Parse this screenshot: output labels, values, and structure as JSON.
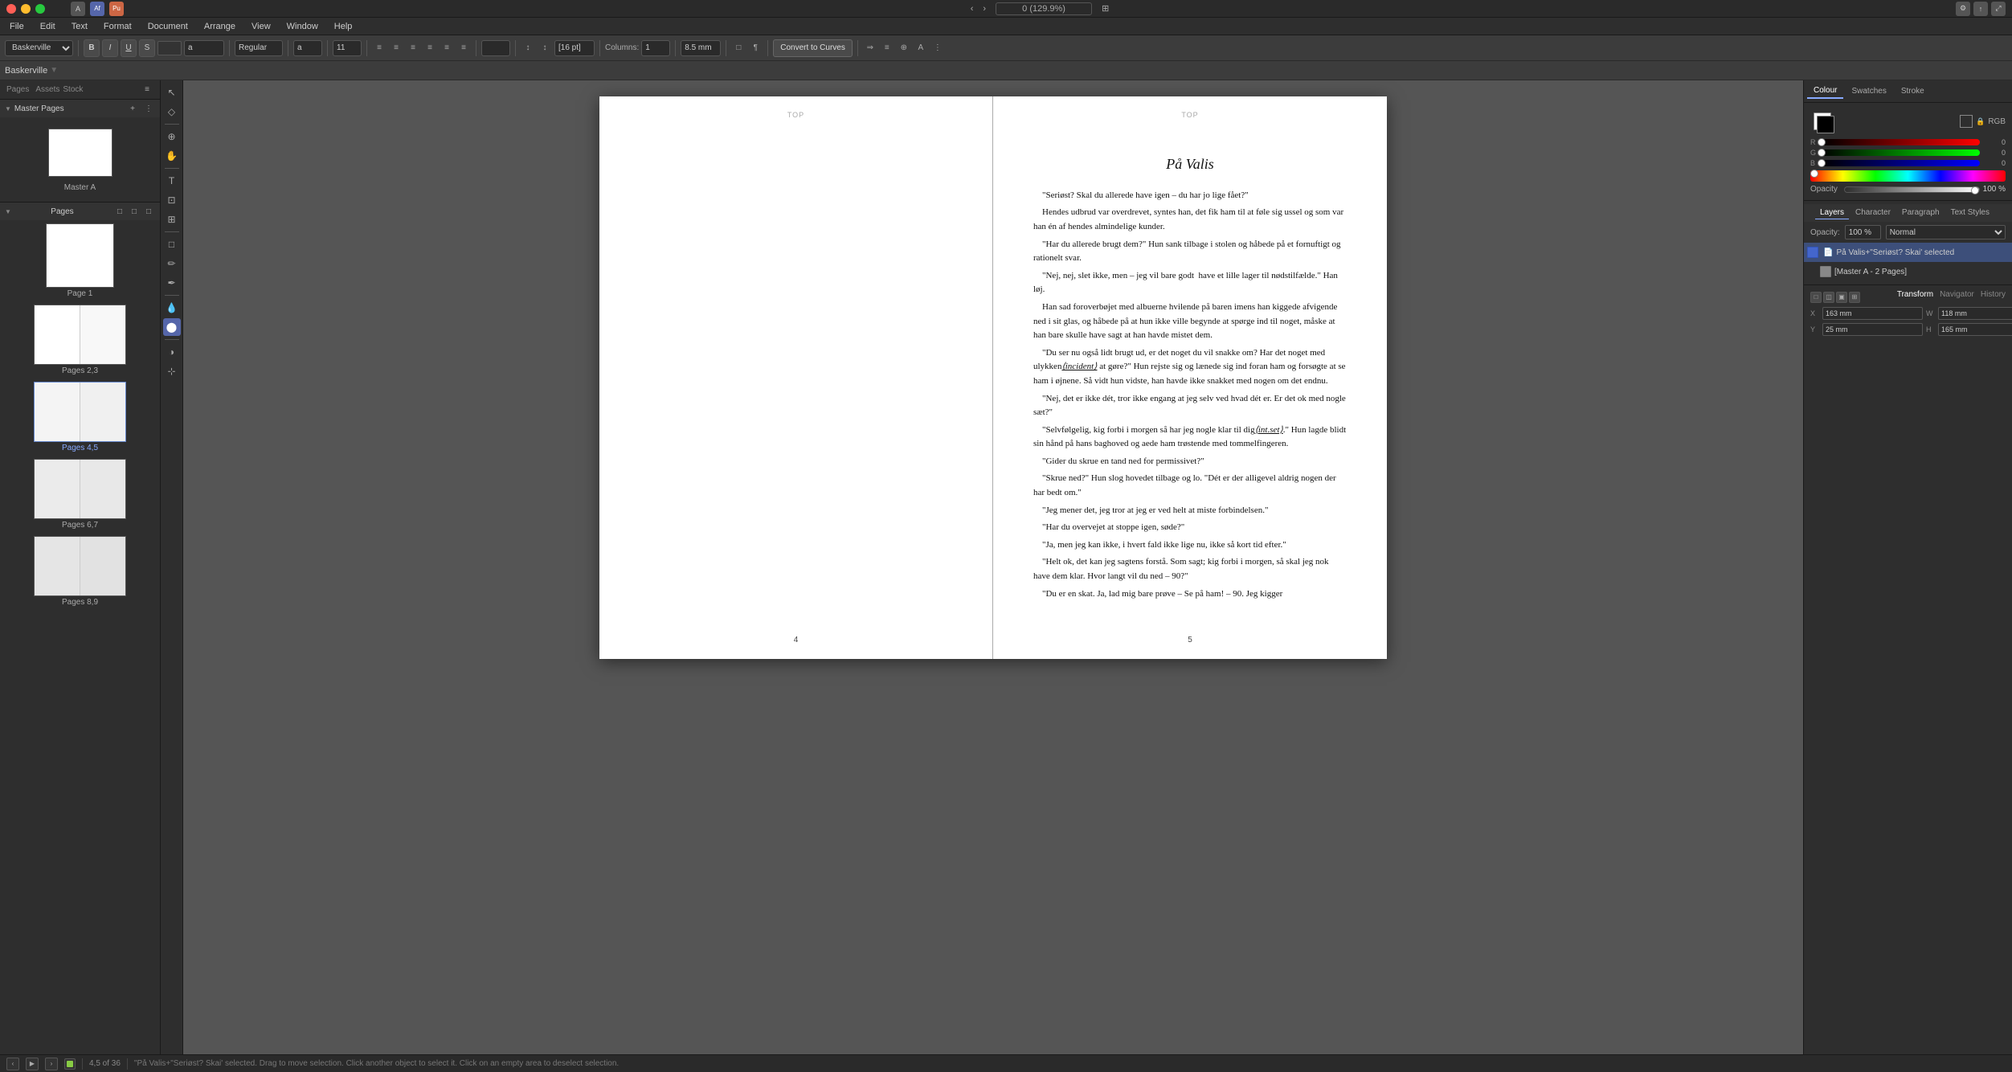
{
  "app": {
    "title": "Affinity Publisher",
    "document_name": "Baskerville"
  },
  "titlebar": {
    "menu_items": [
      "File",
      "Edit",
      "Text",
      "Format",
      "Document",
      "Arrange",
      "View",
      "Window",
      "Help"
    ]
  },
  "toolbar": {
    "font": "Baskerville",
    "font_style": "Regular",
    "font_size": "11",
    "bold_label": "B",
    "italic_label": "I",
    "underline_label": "U",
    "strikethrough_label": "S",
    "convert_to_curves": "Convert to Curves",
    "columns_label": "Columns:",
    "columns_value": "1",
    "gutter_value": "8.5 mm",
    "zoom": "0 (129.9%)"
  },
  "left_panel": {
    "title": "Pages",
    "tabs": [
      "Pages",
      "Assets",
      "Stock"
    ],
    "master_pages_label": "Master Pages",
    "master_page_label": "Master A",
    "pages_label": "Pages",
    "page_groups": [
      {
        "label": "Page 1",
        "type": "single"
      },
      {
        "label": "Pages 2,3",
        "type": "spread"
      },
      {
        "label": "Pages 4,5",
        "type": "spread",
        "selected": true
      },
      {
        "label": "Pages 6,7",
        "type": "spread"
      },
      {
        "label": "Pages 8,9",
        "type": "spread"
      }
    ]
  },
  "canvas": {
    "page_left_number": "4",
    "page_right_number": "5",
    "top_label": "TOP",
    "title": "På Valis",
    "paragraphs": [
      "\"Seriøst? Skal du allerede have igen – du har jo lige fået?\"",
      "Hendes udbrud var overdrevet, syntes han, det fik ham til at føle sig ussel og som var han én af hendes almindelige kunder.",
      "\"Har du allerede brugt dem?\" Hun sank tilbage i stolen og håbede på et fornuftigt og rationelt svar.",
      "\"Nej, nej, slet ikke, men – jeg vil bare godt  have et lille lager til nødstilfælde.\" Han løj.",
      "Han sad foroverbøjet med albuerne hvilende på baren imens han kiggede afvigende ned i sit glas, og håbede på at hun ikke ville begynde at spørge ind til noget, måske at han bare skulle have sagt at han havde mistet dem.",
      "\"Du ser nu også lidt brugt ud, er det noget du vil snakke om? Har det noget med ulykken(incident) at gøre?\" Hun rejste sig og lænede sig ind foran ham og forsøgte at se ham i øjnene. Så vidt hun vidste, han havde ikke snakket med nogen om det endnu.",
      "\"Nej, det er ikke dét, tror ikke engang at jeg selv ved hvad dét er. Er det ok med nogle sæt?\"",
      "\"Selvfølgelig, kig forbi i morgen så har jeg nogle klar til dig(int.set).\" Hun lagde blidt sin hånd på hans baghoved og aede ham trøstende med tommelfingeren.",
      "\"Gider du skrue en tand ned for permissivet?\"",
      "\"Skrue ned?\" Hun slog hovedet tilbage og lo. \"Dét er der alligevel aldrig nogen der har bedt om.\"",
      "\"Jeg mener det, jeg tror at jeg er ved helt at miste forbindelsen.\"",
      "\"Har du overvejet at stoppe igen, søde?\"",
      "\"Ja, men jeg kan ikke, i hvert fald ikke lige nu, ikke så kort tid efter.\"",
      "\"Helt ok, det kan jeg sagtens forstå. Som sagt; kig forbi i morgen, så skal jeg nok have dem klar. Hvor langt vil du ned – 90?\"",
      "\"Du er en skat. Ja, lad mig bare prøve – Se på ham! – 90. Jeg kigger"
    ]
  },
  "right_panel": {
    "tabs": [
      "Colour",
      "Swatches",
      "Stroke"
    ],
    "active_tab": "Colour",
    "color_mode": "RGB",
    "opacity_label": "Opacity",
    "opacity_value": "100 %",
    "layers": {
      "tabs": [
        "Layers",
        "Character",
        "Paragraph",
        "Text Styles"
      ],
      "active_tab": "Layers",
      "opacity_value": "100 %",
      "blend_mode": "Normal",
      "items": [
        {
          "name": "På Valis + \"Seriøst? Skai\" selected",
          "sub": "",
          "active": true,
          "color": "#4466cc"
        },
        {
          "name": "[Master A - 2 Pages]",
          "sub": "",
          "active": false,
          "color": "#888"
        }
      ]
    },
    "transform": {
      "tabs": [
        "Transform",
        "Navigator",
        "History"
      ],
      "active_tab": "Transform",
      "x_label": "X",
      "x_value": "163 mm",
      "y_label": "Y",
      "y_value": "25 mm",
      "w_label": "W",
      "w_value": "118 mm",
      "h_label": "H",
      "h_value": "165 mm"
    }
  },
  "status_bar": {
    "page_info": "4,5 of 36",
    "status_text": "\"På Valis+\"Seriøst? Skai' selected. Drag to move selection. Click another object to select it. Click on an empty area to deselect selection."
  }
}
